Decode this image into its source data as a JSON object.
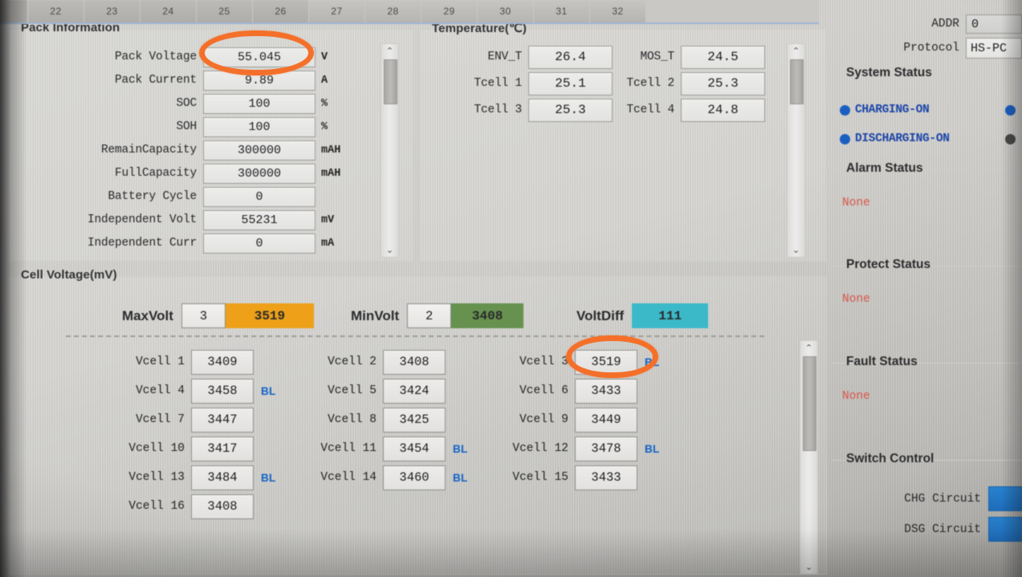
{
  "tabs": {
    "items": [
      "22",
      "23",
      "24",
      "25",
      "26",
      "27",
      "28",
      "29",
      "30",
      "31",
      "32"
    ]
  },
  "pack_information": {
    "title": "Pack Information",
    "fields": [
      {
        "label": "Pack Voltage",
        "value": "55.045",
        "unit": "V"
      },
      {
        "label": "Pack Current",
        "value": "9.89",
        "unit": "A"
      },
      {
        "label": "SOC",
        "value": "100",
        "unit": "%"
      },
      {
        "label": "SOH",
        "value": "100",
        "unit": "%"
      },
      {
        "label": "RemainCapacity",
        "value": "300000",
        "unit": "mAH"
      },
      {
        "label": "FullCapacity",
        "value": "300000",
        "unit": "mAH"
      },
      {
        "label": "Battery Cycle",
        "value": "0",
        "unit": ""
      },
      {
        "label": "Independent Volt",
        "value": "55231",
        "unit": "mV"
      },
      {
        "label": "Independent Curr",
        "value": "0",
        "unit": "mA"
      }
    ]
  },
  "temperature": {
    "title": "Temperature(℃)",
    "fields": [
      {
        "label": "ENV_T",
        "value": "26.4"
      },
      {
        "label": "MOS_T",
        "value": "24.5"
      },
      {
        "label": "Tcell 1",
        "value": "25.1"
      },
      {
        "label": "Tcell 2",
        "value": "25.3"
      },
      {
        "label": "Tcell 3",
        "value": "25.3"
      },
      {
        "label": "Tcell 4",
        "value": "24.8"
      }
    ]
  },
  "cell_voltage": {
    "title": "Cell Voltage(mV)",
    "maxvolt": {
      "label": "MaxVolt",
      "index": "3",
      "value": "3519",
      "color": "#eda018"
    },
    "minvolt": {
      "label": "MinVolt",
      "index": "2",
      "value": "3408",
      "color": "#66914f"
    },
    "voltdiff": {
      "label": "VoltDiff",
      "value": "111",
      "color": "#3bb9c9"
    },
    "balance_flag": "BL",
    "cells": [
      {
        "label": "Vcell 1",
        "value": "3409",
        "balancing": false
      },
      {
        "label": "Vcell 2",
        "value": "3408",
        "balancing": false
      },
      {
        "label": "Vcell 3",
        "value": "3519",
        "balancing": true
      },
      {
        "label": "Vcell 4",
        "value": "3458",
        "balancing": true
      },
      {
        "label": "Vcell 5",
        "value": "3424",
        "balancing": false
      },
      {
        "label": "Vcell 6",
        "value": "3433",
        "balancing": false
      },
      {
        "label": "Vcell 7",
        "value": "3447",
        "balancing": false
      },
      {
        "label": "Vcell 8",
        "value": "3425",
        "balancing": false
      },
      {
        "label": "Vcell 9",
        "value": "3449",
        "balancing": false
      },
      {
        "label": "Vcell 10",
        "value": "3417",
        "balancing": false
      },
      {
        "label": "Vcell 11",
        "value": "3454",
        "balancing": true
      },
      {
        "label": "Vcell 12",
        "value": "3478",
        "balancing": true
      },
      {
        "label": "Vcell 13",
        "value": "3484",
        "balancing": true
      },
      {
        "label": "Vcell 14",
        "value": "3460",
        "balancing": true
      },
      {
        "label": "Vcell 15",
        "value": "3433",
        "balancing": false
      },
      {
        "label": "Vcell 16",
        "value": "3408",
        "balancing": false
      }
    ]
  },
  "connection": {
    "addr_label": "ADDR",
    "addr_value": "0",
    "protocol_label": "Protocol",
    "protocol_value": "HS-PC"
  },
  "system_status": {
    "title": "System Status",
    "rows": [
      {
        "label": "CHARGING-ON",
        "left_state": "on",
        "right_state": "on"
      },
      {
        "label": "DISCHARGING-ON",
        "left_state": "on",
        "right_state": "off"
      }
    ]
  },
  "alarm_status": {
    "title": "Alarm Status",
    "value": "None"
  },
  "protect_status": {
    "title": "Protect Status",
    "value": "None"
  },
  "fault_status": {
    "title": "Fault Status",
    "value": "None"
  },
  "switch_control": {
    "title": "Switch Control",
    "rows": [
      {
        "label": "CHG Circuit"
      },
      {
        "label": "DSG Circuit"
      }
    ]
  },
  "icons": {
    "scroll_up": "⌃",
    "scroll_down": "⌄"
  }
}
